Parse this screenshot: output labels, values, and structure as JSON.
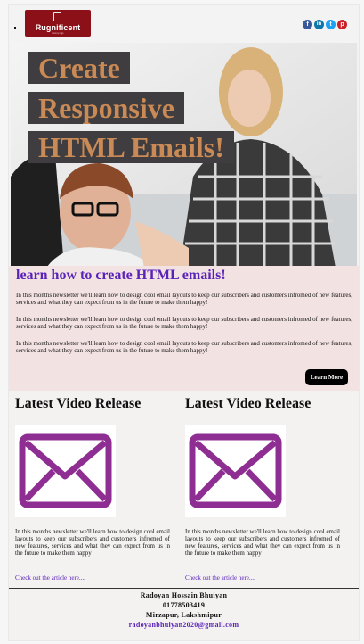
{
  "header": {
    "logo_text": "Rugnificent",
    "logo_tagline": "Luxury rugs",
    "socials": [
      {
        "name": "facebook",
        "glyph": "f",
        "color": "#3b5998"
      },
      {
        "name": "linkedin",
        "glyph": "in",
        "color": "#0e76a8"
      },
      {
        "name": "twitter",
        "glyph": "t",
        "color": "#1da1f2"
      },
      {
        "name": "pinterest",
        "glyph": "p",
        "color": "#cb2027"
      }
    ]
  },
  "hero": {
    "title_lines": [
      "Create",
      "Responsive",
      "HTML Emails!"
    ]
  },
  "intro": {
    "heading": "learn how to create HTML emails!",
    "paragraphs": [
      "In this months newsletter we'll learn how to design cool email layouts to keep our subscribers and customers infromed of new features, services and what they can expect from us in the future to make them happy!",
      "In this months newsletter we'll learn how to design cool email layouts to keep our subscribers and customers infromed of new features, services and what they can expect from us in the future to make them happy!",
      "In this months newsletter we'll learn how to design cool email layouts to keep our subscribers and customers infromed of new features, services and what they can expect from us in the future to make them happy!"
    ],
    "button_label": "Learn More"
  },
  "videos": [
    {
      "heading": "Latest Video Release",
      "icon": "envelope-icon",
      "text": "In this months newsletter we'll learn how to design cool email layouts to keep our subscribers and customers infromed of new features, services and what they can expect from us in the future to make them happy",
      "link": "Check out the article here...."
    },
    {
      "heading": "Latest Video Release",
      "icon": "envelope-icon",
      "text": "In this months newsletter we'll learn how to design cool email layouts to keep our subscribers and customers infromed of new features, services and what they can expect from us in the future to make them happy",
      "link": "Check out the article here...."
    }
  ],
  "footer": {
    "name": "Radoyan Hossain Bhuiyan",
    "phone": "01778503419",
    "address": "Mirzapur, Lakshmipur",
    "email": "radoyanbhuiyan2020@gmail.com"
  },
  "colors": {
    "accent": "#5a23b8",
    "envelope": "#8e2e92",
    "hero_text": "#c98a55"
  }
}
